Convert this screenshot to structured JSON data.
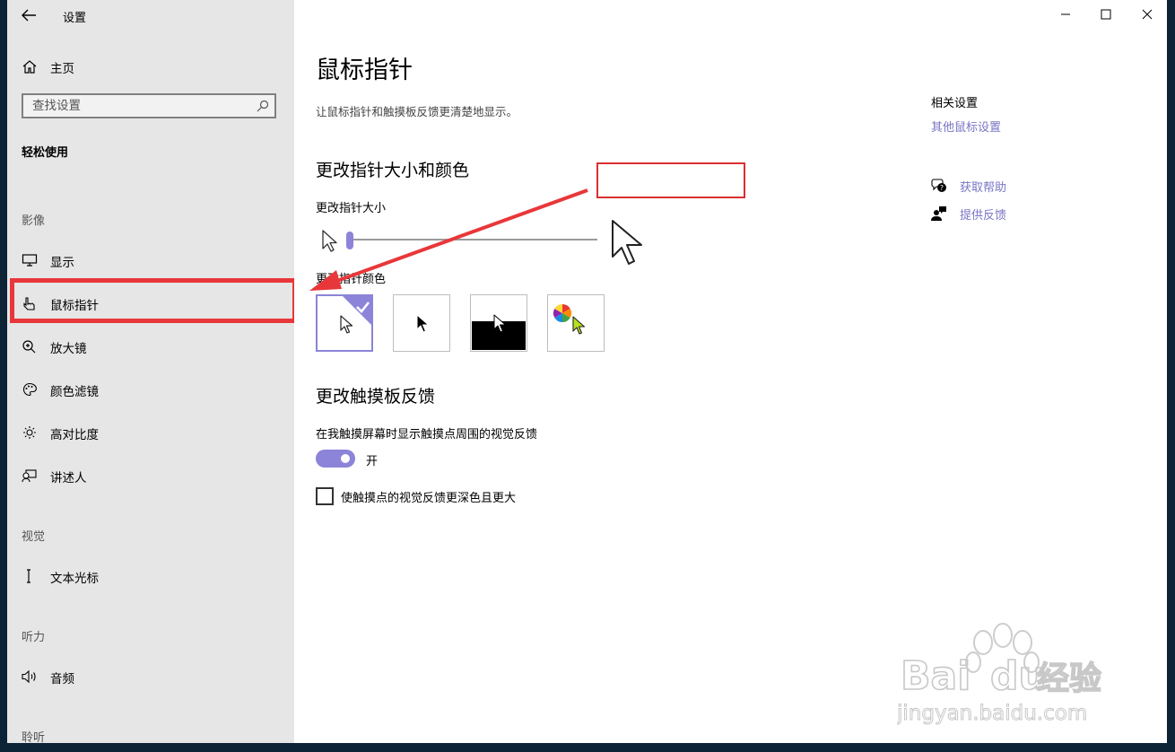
{
  "app": {
    "title": "设置"
  },
  "sidebar": {
    "home_label": "主页",
    "search_placeholder": "查找设置",
    "category_title": "轻松使用",
    "sections": [
      {
        "heading": "影像",
        "items": [
          {
            "label": "显示",
            "icon": "monitor-icon"
          },
          {
            "label": "鼠标指针",
            "icon": "mouse-pointer-icon",
            "selected": true
          },
          {
            "label": "放大镜",
            "icon": "magnifier-icon"
          },
          {
            "label": "颜色滤镜",
            "icon": "palette-icon"
          },
          {
            "label": "高对比度",
            "icon": "brightness-icon"
          },
          {
            "label": "讲述人",
            "icon": "narrator-icon"
          }
        ]
      },
      {
        "heading": "视觉",
        "items": [
          {
            "label": "文本光标",
            "icon": "text-cursor-icon"
          }
        ]
      },
      {
        "heading": "听力",
        "items": [
          {
            "label": "音频",
            "icon": "speaker-icon"
          }
        ]
      },
      {
        "heading": "聆听",
        "items": []
      }
    ]
  },
  "main": {
    "title": "鼠标指针",
    "description": "让鼠标指针和触摸板反馈更清楚地显示。",
    "size_color_heading": "更改指针大小和颜色",
    "size_label": "更改指针大小",
    "pointer_size_level": 1,
    "color_label": "更改指针颜色",
    "color_options": [
      "white",
      "black",
      "inverted",
      "custom"
    ],
    "selected_color_option": "white",
    "touch_heading": "更改触摸板反馈",
    "touch_feedback_label": "在我触摸屏幕时显示触摸点周围的视觉反馈",
    "touch_toggle_state": "开",
    "touch_toggle_on": true,
    "darker_checkbox_label": "使触摸点的视觉反馈更深色且更大",
    "darker_checkbox_checked": false
  },
  "related": {
    "heading": "相关设置",
    "link": "其他鼠标设置",
    "help_links": [
      {
        "label": "获取帮助",
        "icon": "help-chat-icon"
      },
      {
        "label": "提供反馈",
        "icon": "feedback-person-icon"
      }
    ]
  },
  "colors": {
    "accent": "#8c84d8",
    "annotation_red": "#e8373a",
    "link": "#7a75c4"
  },
  "watermark": {
    "brand": "Baidu经验",
    "url": "jingyan.baidu.com"
  }
}
